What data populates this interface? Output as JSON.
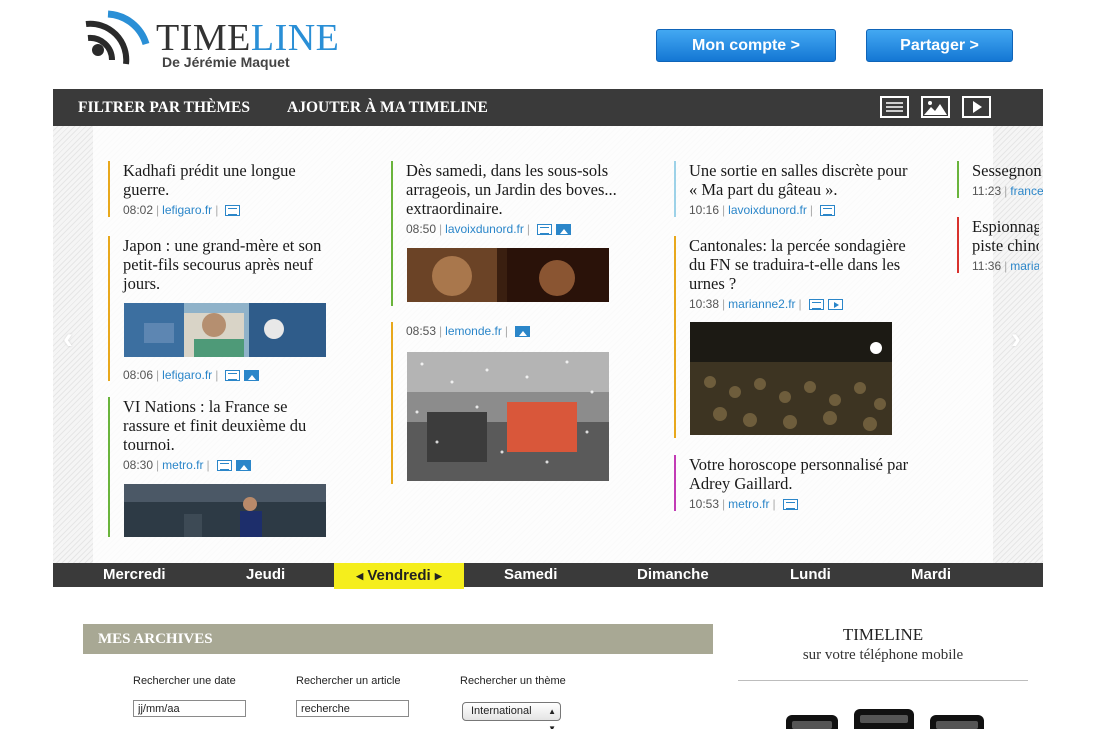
{
  "header": {
    "brand_part1": "TIME",
    "brand_part2": "LINE",
    "byline": "De Jérémie Maquet",
    "account_button": "Mon compte >",
    "share_button": "Partager >"
  },
  "nav": {
    "filter": "FILTRER PAR THÈMES",
    "add": "AJOUTER À MA TIMELINE",
    "view_icons": [
      "list-view-icon",
      "image-view-icon",
      "video-view-icon"
    ]
  },
  "timeline": {
    "columns": [
      {
        "items": [
          {
            "title": "Kadhafi prédit une longue guerre.",
            "time": "08:02",
            "source": "lefigaro.fr",
            "icons": [
              "doc"
            ],
            "color": "#e8a81c"
          },
          {
            "title": "Japon : une grand-mère et son petit-fils secourus après neuf jours.",
            "time": "08:06",
            "source": "lefigaro.fr",
            "icons": [
              "doc",
              "img"
            ],
            "color": "#e8a81c"
          },
          {
            "title": "VI Nations : la France se rassure et finit deuxième du tournoi.",
            "time": "08:30",
            "source": "metro.fr",
            "icons": [
              "doc",
              "img"
            ],
            "color": "#6ab43c"
          }
        ]
      },
      {
        "items": [
          {
            "title": "Dès samedi, dans les sous-sols arrageois, un Jardin des boves... extraordinaire.",
            "time": "08:50",
            "source": "lavoixdunord.fr",
            "icons": [
              "doc",
              "img"
            ],
            "color": "#6ab43c"
          },
          {
            "title": "",
            "time": "08:53",
            "source": "lemonde.fr",
            "icons": [
              "img"
            ],
            "color": "#e8a81c"
          }
        ]
      },
      {
        "items": [
          {
            "title": "Une sortie en salles discrète pour « Ma part du gâteau ».",
            "time": "10:16",
            "source": "lavoixdunord.fr",
            "icons": [
              "doc"
            ],
            "color": "#9dd2e8"
          },
          {
            "title": "Cantonales: la percée sondagière du FN se traduira-t-elle dans les urnes ?",
            "time": "10:38",
            "source": "marianne2.fr",
            "icons": [
              "doc",
              "vid"
            ],
            "color": "#e8a81c"
          },
          {
            "title": "Votre horoscope personnalisé par Adrey Gaillard.",
            "time": "10:53",
            "source": "metro.fr",
            "icons": [
              "doc"
            ],
            "color": "#c23bb5"
          }
        ]
      },
      {
        "items": [
          {
            "title": "Sessegnon",
            "time": "11:23",
            "source": "france",
            "icons": [],
            "color": "#6ab43c"
          },
          {
            "title": "Espionnage piste chino",
            "time": "11:36",
            "source": "maria",
            "icons": [],
            "color": "#d8322d"
          }
        ]
      }
    ]
  },
  "days": {
    "items": [
      "Mercredi",
      "Jeudi",
      "Vendredi",
      "Samedi",
      "Dimanche",
      "Lundi",
      "Mardi"
    ],
    "active": "Vendredi"
  },
  "archives": {
    "title": "MES ARCHIVES",
    "date_label": "Rechercher une date",
    "date_value": "jj/mm/aa",
    "article_label": "Rechercher un article",
    "article_value": "recherche",
    "theme_label": "Rechercher un thème",
    "theme_value": "International"
  },
  "mobile": {
    "title": "TIMELINE",
    "subtitle": "sur votre téléphone mobile"
  }
}
